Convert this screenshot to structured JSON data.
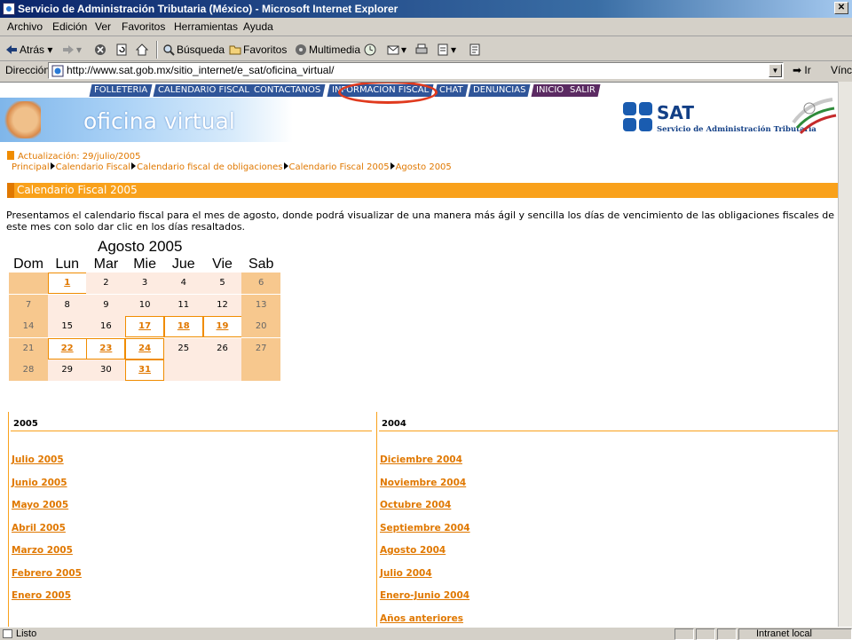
{
  "window": {
    "title": "Servicio de Administración Tributaria (México) - Microsoft Internet Explorer"
  },
  "menu": [
    "Archivo",
    "Edición",
    "Ver",
    "Favoritos",
    "Herramientas",
    "Ayuda"
  ],
  "toolbar": {
    "back": "Atrás",
    "search": "Búsqueda",
    "favorites": "Favoritos",
    "media": "Multimedia"
  },
  "address": {
    "label": "Dirección",
    "url": "http://www.sat.gob.mx/sitio_internet/e_sat/oficina_virtual/",
    "go": "Ir",
    "links": "Vínculos"
  },
  "nav": [
    "FOLLETERIA",
    "CALENDARIO FISCAL",
    "CONTACTANOS",
    "INFORMACION FISCAL",
    "CHAT",
    "DENUNCIAS",
    "INICIO",
    "SALIR"
  ],
  "banner": {
    "title": "oficina virtual",
    "sat": "SAT",
    "sat_sub": "Servicio de Administración Tributaria"
  },
  "update": "Actualización: 29/julio/2005",
  "breadcrumb": [
    "Principal",
    "Calendario Fiscal",
    "Calendario fiscal de obligaciones",
    "Calendario Fiscal 2005",
    "Agosto 2005"
  ],
  "section_title": "Calendario Fiscal 2005",
  "intro": "Presentamos el calendario fiscal para el mes de agosto, donde podrá visualizar de una manera más ágil y sencilla los días de vencimiento de las obligaciones fiscales de este mes con solo dar clic en los días resaltados.",
  "calendar": {
    "title": "Agosto 2005",
    "daynames": [
      "Dom",
      "Lun",
      "Mar",
      "Mie",
      "Jue",
      "Vie",
      "Sab"
    ],
    "weeks": [
      [
        "",
        "1",
        "2",
        "3",
        "4",
        "5",
        "6"
      ],
      [
        "7",
        "8",
        "9",
        "10",
        "11",
        "12",
        "13"
      ],
      [
        "14",
        "15",
        "16",
        "17",
        "18",
        "19",
        "20"
      ],
      [
        "21",
        "22",
        "23",
        "24",
        "25",
        "26",
        "27"
      ],
      [
        "28",
        "29",
        "30",
        "31",
        "",
        "",
        ""
      ]
    ],
    "linked_days": [
      "1",
      "17",
      "18",
      "19",
      "22",
      "23",
      "24",
      "31"
    ]
  },
  "archive": {
    "col2005": {
      "year": "2005",
      "links": [
        "Julio 2005",
        "Junio 2005",
        "Mayo 2005",
        "Abril 2005",
        "Marzo 2005",
        "Febrero 2005",
        "Enero 2005"
      ]
    },
    "col2004": {
      "year": "2004",
      "links": [
        "Diciembre 2004",
        "Noviembre 2004",
        "Octubre 2004",
        "Septiembre 2004",
        "Agosto 2004",
        "Julio 2004",
        "Enero-Junio 2004",
        "Años anteriores"
      ]
    }
  },
  "status": {
    "text": "Listo",
    "zone": "Intranet local"
  },
  "colors": {
    "orange": "#f9a11b",
    "nav_blue": "#2f5599",
    "highlight": "#e03a1e"
  }
}
